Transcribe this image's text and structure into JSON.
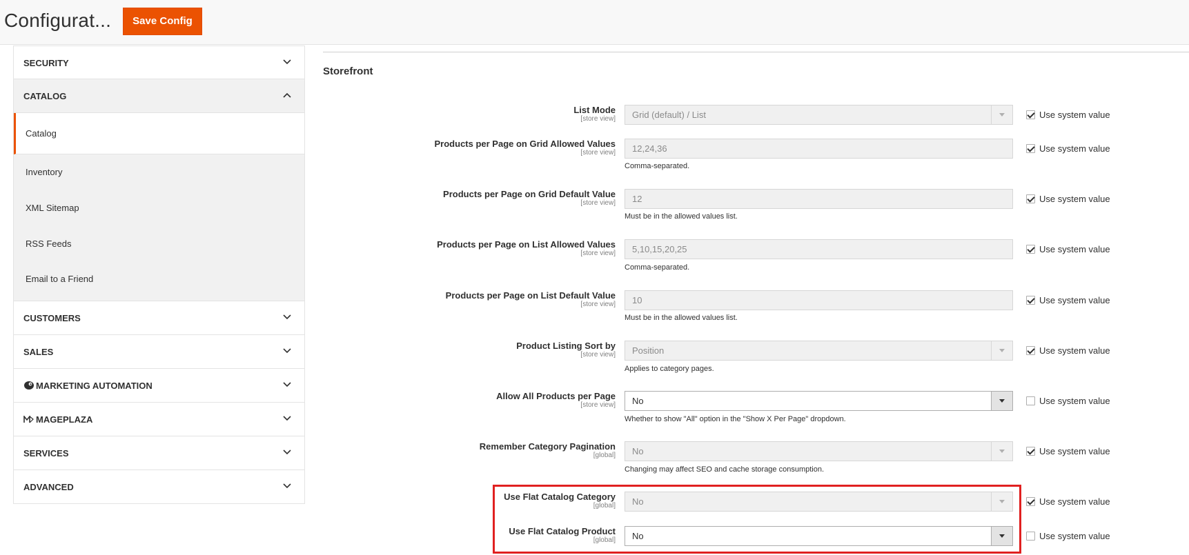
{
  "header": {
    "title": "Configurat...",
    "save_label": "Save Config"
  },
  "sidebar": {
    "sections": [
      {
        "label": "SECURITY"
      },
      {
        "label": "CATALOG"
      },
      {
        "label": "CUSTOMERS"
      },
      {
        "label": "SALES"
      },
      {
        "label": "MARKETING AUTOMATION"
      },
      {
        "label": "MAGEPLAZA"
      },
      {
        "label": "SERVICES"
      },
      {
        "label": "ADVANCED"
      }
    ],
    "catalog_items": [
      {
        "label": "Catalog"
      },
      {
        "label": "Inventory"
      },
      {
        "label": "XML Sitemap"
      },
      {
        "label": "RSS Feeds"
      },
      {
        "label": "Email to a Friend"
      }
    ]
  },
  "main": {
    "section_title": "Storefront",
    "use_system_label": "Use system value",
    "fields": [
      {
        "label": "List Mode",
        "scope": "[store view]",
        "value": "Grid (default) / List",
        "note": "",
        "use_system": true
      },
      {
        "label": "Products per Page on Grid Allowed Values",
        "scope": "[store view]",
        "value": "12,24,36",
        "note": "Comma-separated.",
        "use_system": true
      },
      {
        "label": "Products per Page on Grid Default Value",
        "scope": "[store view]",
        "value": "12",
        "note": "Must be in the allowed values list.",
        "use_system": true
      },
      {
        "label": "Products per Page on List Allowed Values",
        "scope": "[store view]",
        "value": "5,10,15,20,25",
        "note": "Comma-separated.",
        "use_system": true
      },
      {
        "label": "Products per Page on List Default Value",
        "scope": "[store view]",
        "value": "10",
        "note": "Must be in the allowed values list.",
        "use_system": true
      },
      {
        "label": "Product Listing Sort by",
        "scope": "[store view]",
        "value": "Position",
        "note": "Applies to category pages.",
        "use_system": true
      },
      {
        "label": "Allow All Products per Page",
        "scope": "[store view]",
        "value": "No",
        "note": "Whether to show \"All\" option in the \"Show X Per Page\" dropdown.",
        "use_system": false
      },
      {
        "label": "Remember Category Pagination",
        "scope": "[global]",
        "value": "No",
        "note": "Changing may affect SEO and cache storage consumption.",
        "use_system": true
      },
      {
        "label": "Use Flat Catalog Category",
        "scope": "[global]",
        "value": "No",
        "note": "",
        "use_system": true
      },
      {
        "label": "Use Flat Catalog Product",
        "scope": "[global]",
        "value": "No",
        "note": "",
        "use_system": false
      }
    ]
  },
  "colors": {
    "accent": "#eb5202",
    "highlight": "#e02020"
  }
}
